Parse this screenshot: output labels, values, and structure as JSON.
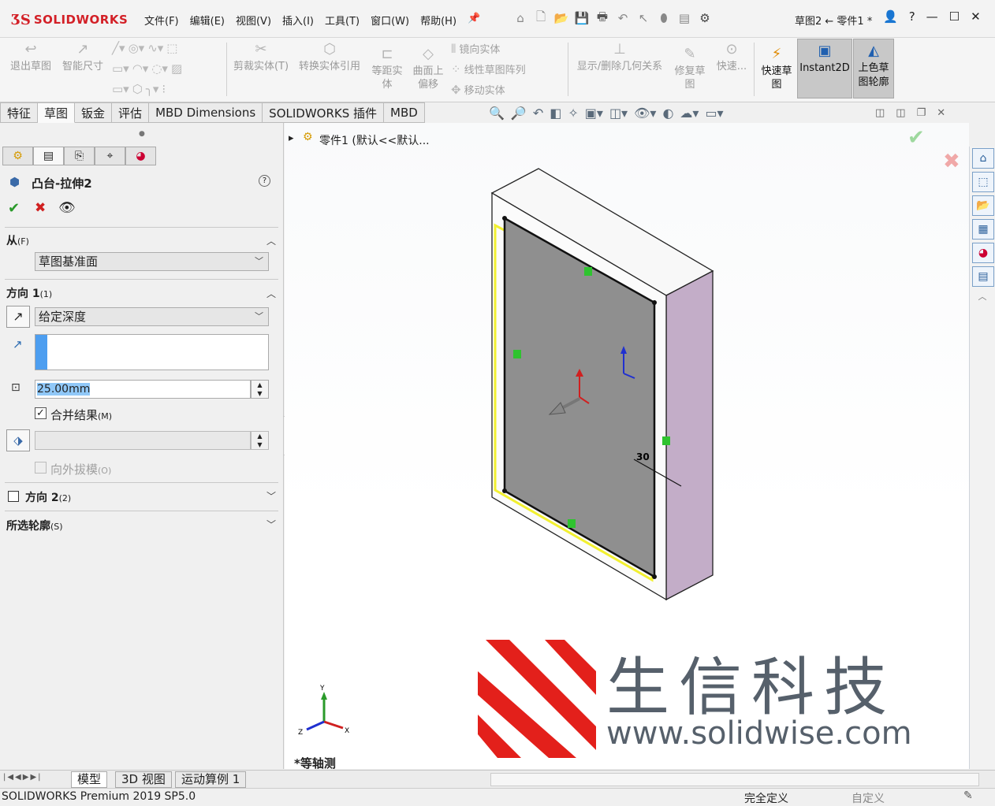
{
  "app": {
    "brand": "SOLIDWORKS",
    "doc_title": "草图2 ← 零件1 *"
  },
  "menus": [
    "文件(F)",
    "编辑(E)",
    "视图(V)",
    "插入(I)",
    "工具(T)",
    "窗口(W)",
    "帮助(H)"
  ],
  "commands": {
    "exit_sketch": "退出草图",
    "smart_dim": "智能尺寸",
    "trim": "剪裁实体(T)",
    "convert": "转换实体引用",
    "offset1": "等距实",
    "offset2": "体",
    "surf_offset1": "曲面上",
    "surf_offset2": "偏移",
    "mirror": "镜向实体",
    "linear_pattern": "线性草图阵列",
    "move": "移动实体",
    "display_relations": "显示/删除几何关系",
    "repair1": "修复草",
    "repair2": "图",
    "quick": "快速...",
    "quick_sketch1": "快速草",
    "quick_sketch2": "图",
    "instant2d": "Instant2D",
    "shaded1": "上色草",
    "shaded2": "图轮廓"
  },
  "tabs": [
    "特征",
    "草图",
    "钣金",
    "评估",
    "MBD Dimensions",
    "SOLIDWORKS 插件",
    "MBD"
  ],
  "active_tab": "草图",
  "feature": {
    "title": "凸台-拉伸2",
    "from_label": "从",
    "from_key": "(F)",
    "from_value": "草图基准面",
    "dir1_label": "方向 1",
    "dir1_key": "(1)",
    "end_condition": "给定深度",
    "depth": "25.00mm",
    "merge_label": "合并结果",
    "merge_key": "(M)",
    "merge_checked": true,
    "draft_label": "向外拔模",
    "draft_key": "(O)",
    "dir2_label": "方向 2",
    "dir2_key": "(2)",
    "contours_label": "所选轮廓",
    "contours_key": "(S)"
  },
  "tree": {
    "item": "零件1 (默认<<默认..."
  },
  "viewport": {
    "view_name": "*等轴测",
    "dim_value": "30"
  },
  "watermark": {
    "cn": "生信科技",
    "url": "www.solidwise.com"
  },
  "triad": {
    "x": "X",
    "y": "Y",
    "z": "Z"
  },
  "bottom_tabs": [
    "模型",
    "3D 视图",
    "运动算例 1"
  ],
  "status": {
    "product": "SOLIDWORKS Premium 2019 SP5.0",
    "state": "完全定义",
    "units": "自定义"
  },
  "colors": {
    "accent": "#d32027",
    "face": "#8f8f8f",
    "side": "#c3adc8",
    "sketch_hl": "#f2f030"
  }
}
